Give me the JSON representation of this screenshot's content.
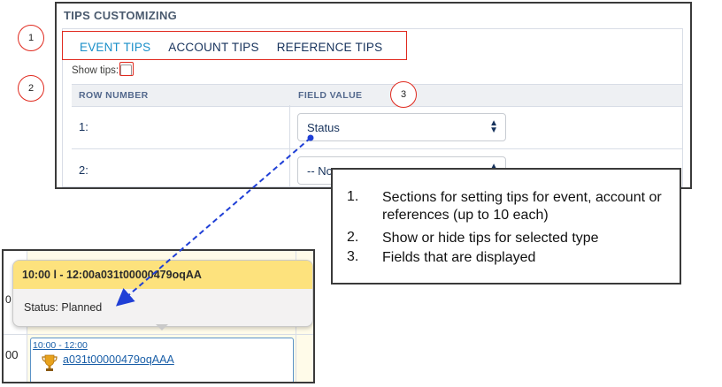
{
  "panel": {
    "title": "TIPS CUSTOMIZING",
    "tabs": [
      {
        "label": "EVENT TIPS",
        "active": true
      },
      {
        "label": "ACCOUNT TIPS",
        "active": false
      },
      {
        "label": "REFERENCE TIPS",
        "active": false
      }
    ],
    "show_tips_label": "Show tips:",
    "show_tips_checked": false,
    "columns": [
      "ROW NUMBER",
      "FIELD VALUE"
    ],
    "rows": [
      {
        "number": "1:",
        "value": "Status"
      },
      {
        "number": "2:",
        "value": "-- None --"
      }
    ]
  },
  "callouts": [
    "1",
    "2",
    "3"
  ],
  "legend": [
    {
      "num": "1.",
      "text": "Sections for setting tips for event, account or references (up to 10 each)"
    },
    {
      "num": "2.",
      "text": "Show or hide tips for selected type"
    },
    {
      "num": "3.",
      "text": "Fields that are displayed"
    }
  ],
  "calendar": {
    "time_left_1": "0",
    "time_left_2": "00",
    "tooltip_title": "10:00 l - 12:00a031t00000479oqAA",
    "tooltip_body": "Status: Planned",
    "event_time": "10:00 - 12:00",
    "event_name": "a031t00000479oqAAA"
  },
  "colors": {
    "accent": "#1a8fc9",
    "callout_red": "#e0291e",
    "arrow_blue": "#1f3fd6",
    "tooltip_header": "#fde27d"
  }
}
